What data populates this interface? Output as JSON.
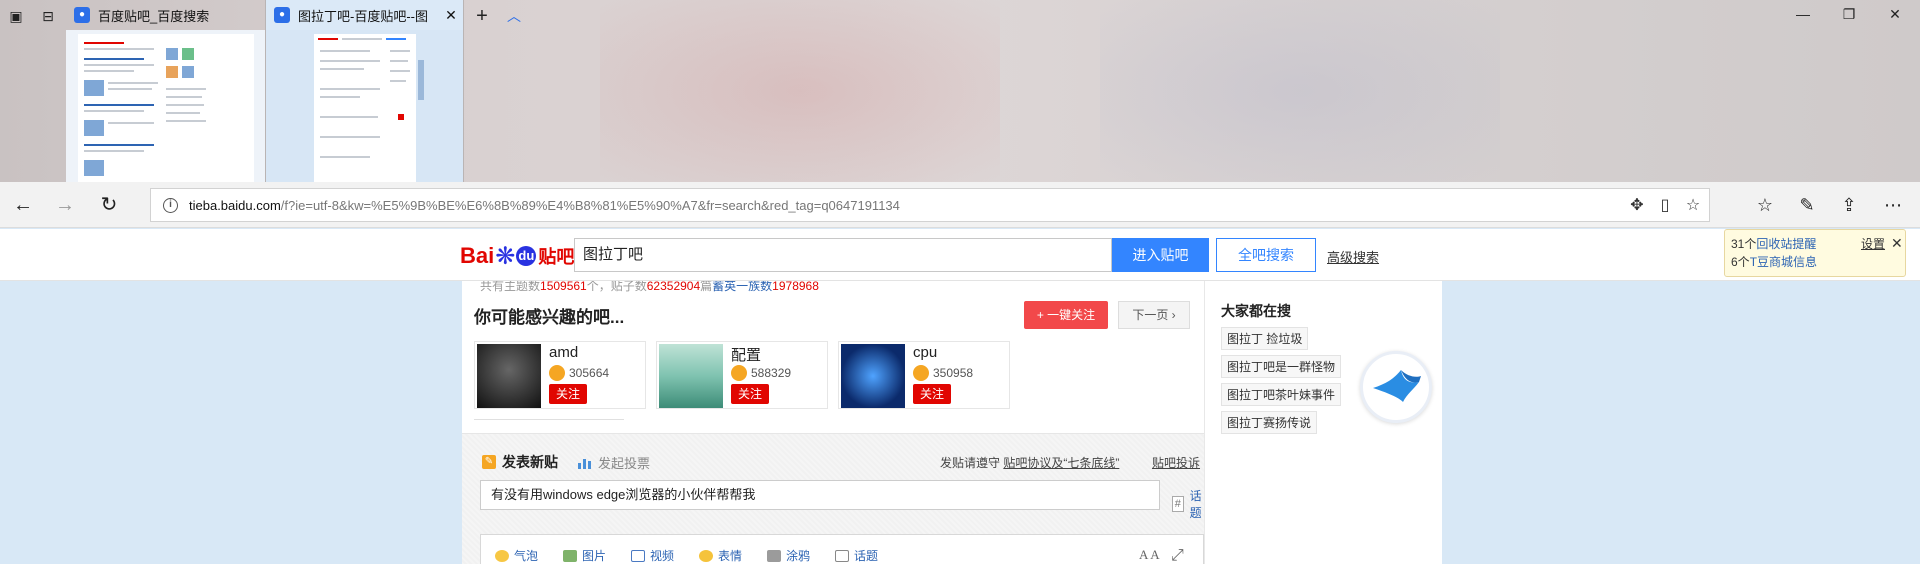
{
  "tabs": [
    {
      "title": "百度贴吧_百度搜索",
      "active": false
    },
    {
      "title": "图拉丁吧-百度贴吧--图",
      "active": true
    }
  ],
  "tabstrip_icons": [
    "set-aside-tabs-icon",
    "tab-list-icon",
    "new-tab-icon",
    "show-previews-icon"
  ],
  "window_controls": [
    "minimize-icon",
    "restore-icon",
    "close-icon"
  ],
  "address_bar": {
    "url_domain": "tieba.baidu.com",
    "url_path": "/f?ie=utf-8&kw=%E5%9B%BE%E6%8B%89%E4%B8%81%E5%90%A7&fr=search&red_tag=q0647191134"
  },
  "header": {
    "search_value": "图拉丁吧",
    "enter_bar_label": "进入贴吧",
    "search_all_label": "全吧搜索",
    "advanced_search_label": "高级搜索",
    "logo_bai": "Bai",
    "logo_du": "du",
    "logo_tieba": "贴吧"
  },
  "notification": {
    "line1_prefix": "31个",
    "line1_link": "回收站提醒",
    "line2_prefix": "6个",
    "line2_link": "T豆商城信息",
    "settings_label": "设置",
    "close": "✕"
  },
  "stats": {
    "label_topics": "共有主题数",
    "topics": "1509561",
    "unit_topics": "个，贴子数",
    "posts": "62352904",
    "unit_posts": "篇",
    "group_link": "蓄英一族数",
    "members": "1978968"
  },
  "recommend": {
    "title": "你可能感兴趣的吧...",
    "follow_all_label": "+ 一键关注",
    "next_page_label": "下一页",
    "bars": [
      {
        "name": "amd",
        "count": "305664",
        "follow": "关注"
      },
      {
        "name": "配置",
        "count": "588329",
        "follow": "关注"
      },
      {
        "name": "cpu",
        "count": "350958",
        "follow": "关注"
      }
    ]
  },
  "hot_search": {
    "title": "大家都在搜",
    "tags": [
      "图拉丁 捡垃圾",
      "图拉丁吧是一群怪物",
      "图拉丁吧茶叶妹事件",
      "图拉丁赛扬传说"
    ]
  },
  "post": {
    "new_post_label": "发表新贴",
    "vote_label": "发起投票",
    "rules_prefix": "发贴请遵守 ",
    "rules_link": "贴吧协议及“七条底线”",
    "complain_label": "贴吧投诉",
    "title_value": "有没有用windows edge浏览器的小伙伴帮帮我",
    "topic_label": "话题",
    "toolbar": [
      "气泡",
      "图片",
      "视频",
      "表情",
      "涂鸦",
      "话题"
    ],
    "font_size_label": "A A"
  },
  "colors": {
    "baidu_blue": "#3385ff",
    "baidu_red": "#e10601",
    "follow_red": "#f2484a",
    "page_bg": "#d8e8f6"
  }
}
